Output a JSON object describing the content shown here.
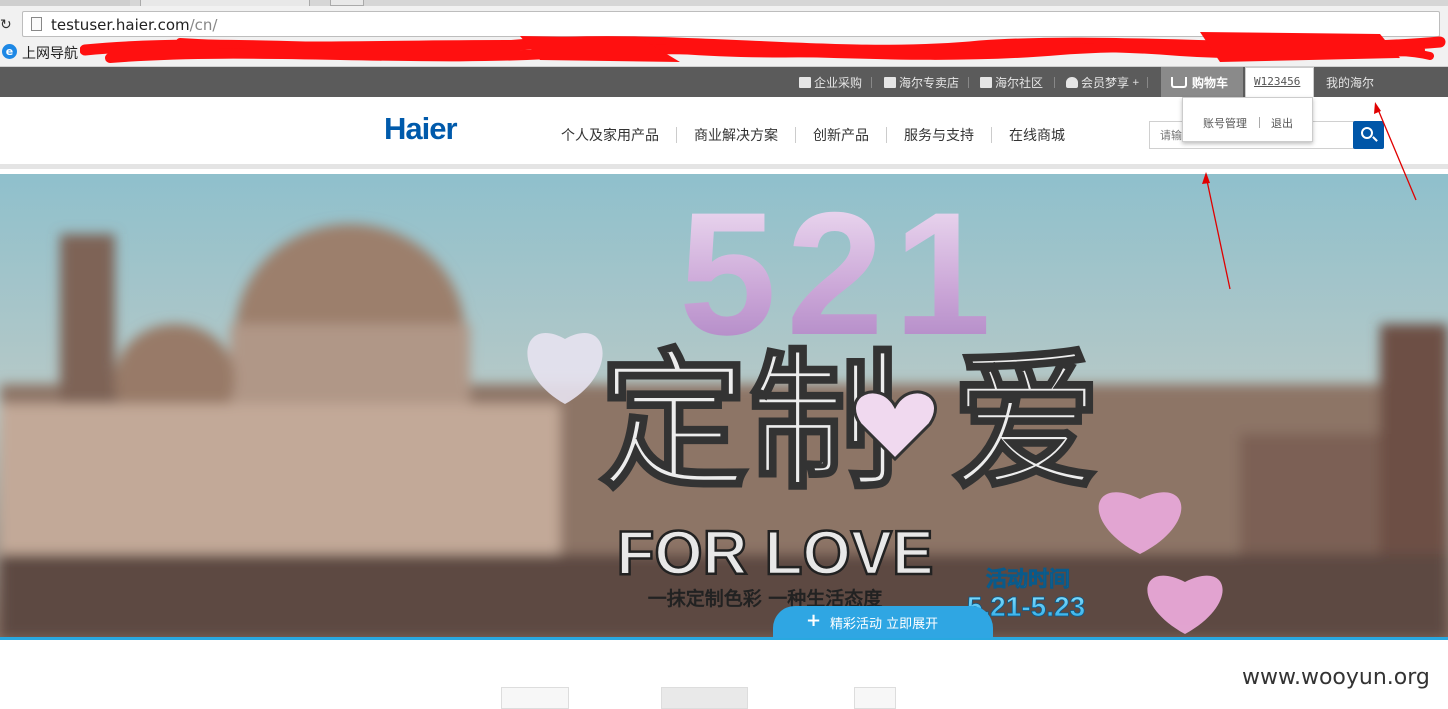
{
  "browser": {
    "url_host": "testuser.haier.com",
    "url_path": "/cn/",
    "bookmark_label": "上网导航"
  },
  "topbar": {
    "items": [
      {
        "label": "企业采购",
        "icon": "shopping-bag-icon"
      },
      {
        "label": "海尔专卖店",
        "icon": "store-icon"
      },
      {
        "label": "海尔社区",
        "icon": "chat-bubbles-icon"
      },
      {
        "label": "会员梦享",
        "sup": "+",
        "icon": "user-icon"
      }
    ],
    "cart_label": "购物车",
    "username": "W123456",
    "my_haier": "我的海尔"
  },
  "account_menu": {
    "manage": "账号管理",
    "logout": "退出"
  },
  "header": {
    "logo": "Haier",
    "nav": [
      "个人及家用产品",
      "商业解决方案",
      "创新产品",
      "服务与支持",
      "在线商城"
    ],
    "search_placeholder": "请输"
  },
  "banner": {
    "big_number": "521",
    "headline": "定制 爱",
    "subtitle": "FOR LOVE",
    "slogan": "一抹定制色彩 一种生活态度",
    "date_label": "活动时间",
    "date_range": "5.21-5.23",
    "expand_label": "精彩活动 立即展开"
  },
  "watermark": "www.wooyun.org",
  "colors": {
    "brand_blue": "#005aab",
    "topbar_gray": "#5b5b5b",
    "accent_cyan": "#2fa6e3",
    "annotation_red": "#e00000"
  }
}
